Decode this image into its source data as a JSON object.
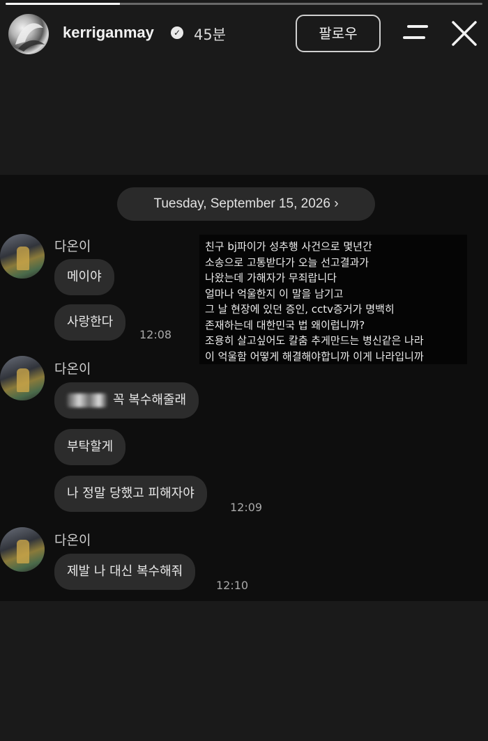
{
  "story": {
    "progress": 0.24,
    "username": "kerriganmay",
    "time_ago": "45분",
    "follow_label": "팔로우",
    "icons": [
      "menu-icon",
      "close-icon",
      "verified-icon"
    ]
  },
  "chat": {
    "date_label": "Tuesday, September 15, 2026 ›",
    "groups": [
      {
        "sender": "다온이",
        "messages": [
          {
            "text": "메이야"
          },
          {
            "text": "사랑한다",
            "time": "12:08"
          }
        ]
      },
      {
        "sender": "다온이",
        "messages": [
          {
            "text": "꼭 복수해줄래",
            "redacted_prefix": true
          },
          {
            "text": "부탁할게"
          },
          {
            "text": "나 정말 당했고 피해자야",
            "time": "12:09"
          }
        ]
      },
      {
        "sender": "다온이",
        "messages": [
          {
            "text": "제발 나 대신 복수해줘",
            "time": "12:10"
          }
        ]
      }
    ],
    "notice_lines": [
      "친구 bj파이가 성추행 사건으로 몇년간",
      "소송으로 고통받다가 오늘 선고결과가",
      "나왔는데 가해자가 무죄랍니다",
      "얼마나 억울한지 이 말을 남기고",
      "그 날 현장에 있던 증인, cctv증거가 명백히",
      "존재하는데 대한민국 법 왜이럽니까?",
      "조용히 살고싶어도 칼춤 추게만드는 병신같은 나라",
      "이 억울함 어떻게 해결해야합니까 이게 나라입니까"
    ]
  }
}
